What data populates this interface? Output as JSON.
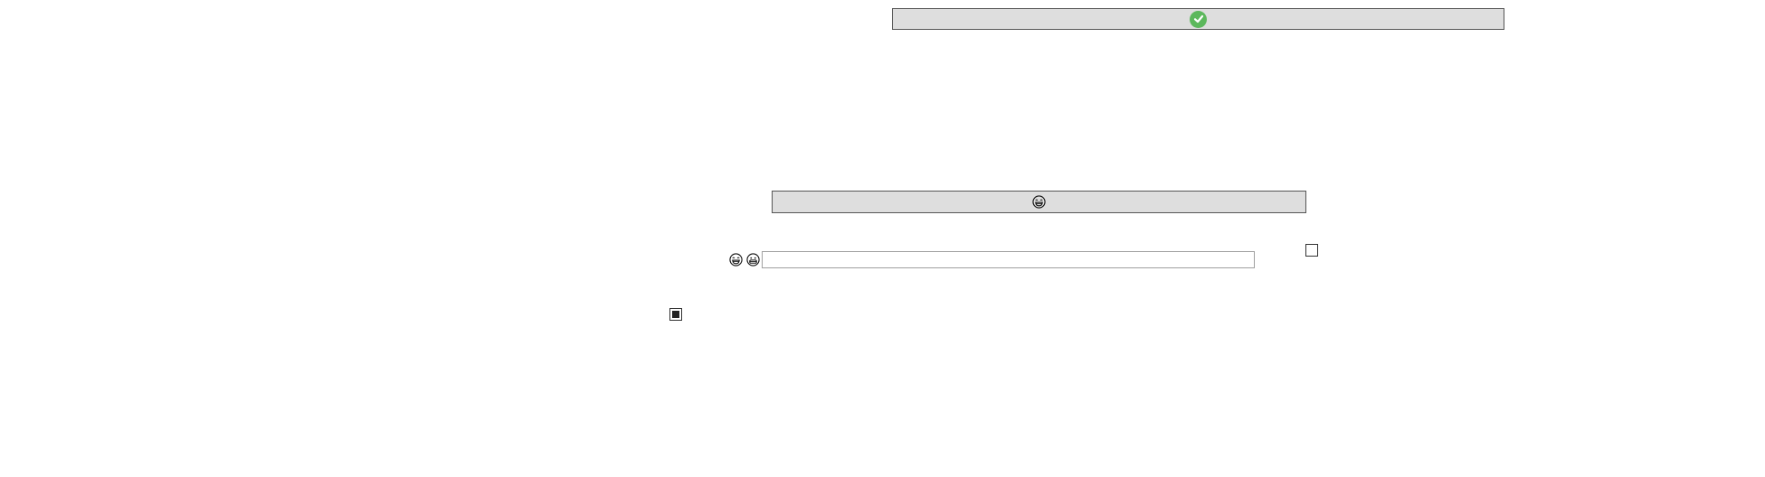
{
  "confirm_button": {
    "icon": "check-circle-icon",
    "icon_color": "#5cb85c"
  },
  "emoji_button": {
    "icon": "laughing-face-icon"
  },
  "emoji_row": {
    "icons": [
      "laughing-face-icon",
      "grinning-face-icon"
    ]
  },
  "text_input": {
    "value": "",
    "placeholder": ""
  },
  "checkbox_a": {
    "checked": false
  },
  "checkbox_b": {
    "checked": true
  },
  "colors": {
    "button_background": "#dedede",
    "button_border": "#555555",
    "input_border": "#a0a0a0"
  }
}
